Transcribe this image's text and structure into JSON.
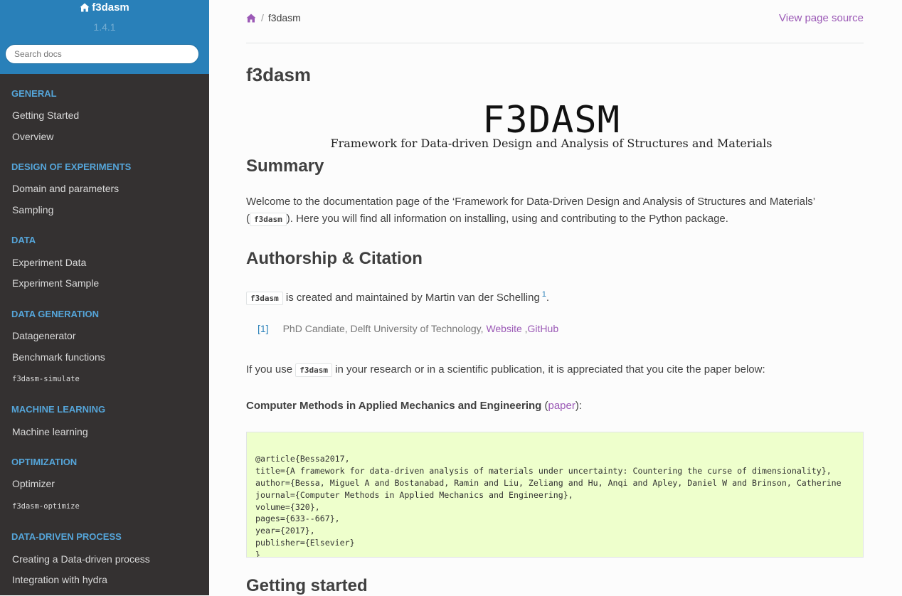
{
  "sidebar": {
    "project": "f3dasm",
    "version": "1.4.1",
    "search_placeholder": "Search docs",
    "sections": [
      {
        "caption": "GENERAL",
        "items": [
          "Getting Started",
          "Overview"
        ]
      },
      {
        "caption": "DESIGN OF EXPERIMENTS",
        "items": [
          "Domain and parameters",
          "Sampling"
        ]
      },
      {
        "caption": "DATA",
        "items": [
          "Experiment Data",
          "Experiment Sample"
        ]
      },
      {
        "caption": "DATA GENERATION",
        "items": [
          "Datagenerator",
          "Benchmark functions",
          "f3dasm-simulate"
        ]
      },
      {
        "caption": "MACHINE LEARNING",
        "items": [
          "Machine learning"
        ]
      },
      {
        "caption": "OPTIMIZATION",
        "items": [
          "Optimizer",
          "f3dasm-optimize"
        ]
      },
      {
        "caption": "DATA-DRIVEN PROCESS",
        "items": [
          "Creating a Data-driven process",
          "Integration with hydra"
        ]
      }
    ]
  },
  "breadcrumb": {
    "current": "f3dasm",
    "view_source": "View page source"
  },
  "page": {
    "title": "f3dasm",
    "logo": {
      "title": "F3DASM",
      "subtitle": "Framework for Data-driven Design and Analysis of Structures and Materials"
    },
    "summary": {
      "heading": "Summary",
      "line1": "Welcome to the documentation page of the ‘Framework for Data-Driven Design and Analysis of Structures and Materials’",
      "line2_pre": "(",
      "code": "f3dasm",
      "line2_post": "). Here you will find all information on installing, using and contributing to the Python package."
    },
    "authorship": {
      "heading": "Authorship & Citation",
      "code": "f3dasm",
      "text": "is created and maintained by Martin van der Schelling",
      "footnote_ref": "1",
      "period": ".",
      "footnote": {
        "label": "[1]",
        "text": "PhD Candiate, Delft University of Technology,",
        "website": "Website",
        "comma": ",",
        "github": "GitHub"
      },
      "use_pre": "If you use",
      "use_code": "f3dasm",
      "use_post": "in your research or in a scientific publication, it is appreciated that you cite the paper below:",
      "journal": "Computer Methods in Applied Mechanics and Engineering",
      "paper_open": "(",
      "paper_link": "paper",
      "paper_close": "):"
    },
    "bibtex": [
      "@article{Bessa2017,",
      "title={A framework for data-driven analysis of materials under uncertainty: Countering the curse of dimensionality},",
      "author={Bessa, Miguel A and Bostanabad, Ramin and Liu, Zeliang and Hu, Anqi and Apley, Daniel W and Brinson, Catherine",
      "journal={Computer Methods in Applied Mechanics and Engineering},",
      "volume={320},",
      "pages={633--667},",
      "year={2017},",
      "publisher={Elsevier}",
      "}"
    ],
    "getting_started": {
      "heading": "Getting started"
    }
  }
}
